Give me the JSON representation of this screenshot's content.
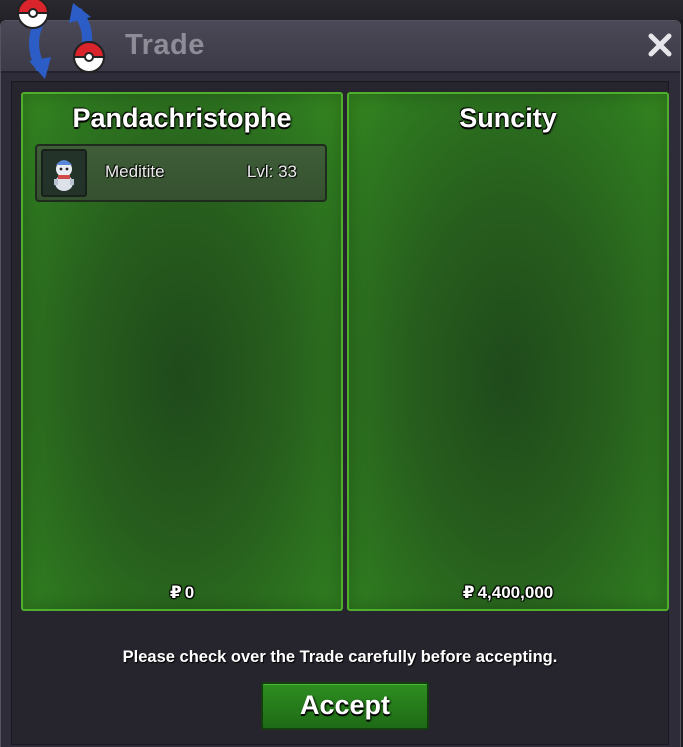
{
  "window": {
    "title": "Trade"
  },
  "trade": {
    "left": {
      "player_name": "Pandachristophe",
      "currency_symbol": "₽",
      "money": "0",
      "items": [
        {
          "name": "Meditite",
          "level_label": "Lvl: 33",
          "icon": "meditite-sprite-icon"
        }
      ]
    },
    "right": {
      "player_name": "Suncity",
      "currency_symbol": "₽",
      "money": "4,400,000",
      "items": []
    }
  },
  "footer": {
    "notice": "Please check over the Trade carefully before accepting.",
    "accept_label": "Accept"
  },
  "icons": {
    "window": "trade-arrows-pokeball-icon",
    "close": "close-icon"
  },
  "colors": {
    "panel_border": "#4fae2b",
    "panel_fill": "#275e1d",
    "accept_fill": "#2d8e20"
  }
}
